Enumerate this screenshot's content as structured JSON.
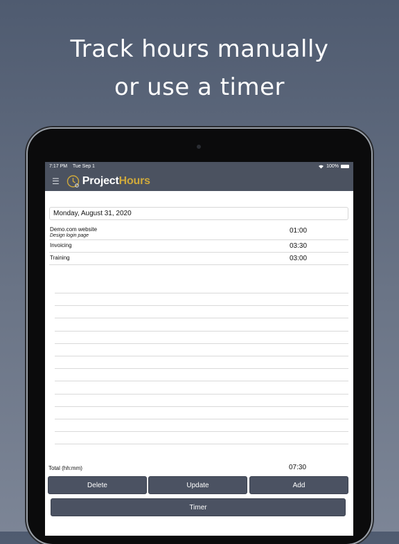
{
  "promo": {
    "line1": "Track hours manually",
    "line2": "or use a timer"
  },
  "statusbar": {
    "time": "7:17 PM",
    "date": "Tue Sep 1",
    "battery": "100%"
  },
  "app": {
    "brand_part1": "Project",
    "brand_part2": "Hours"
  },
  "date_value": "Monday, August 31, 2020",
  "entries": [
    {
      "name": "Demo.com website",
      "sub": "Design login page",
      "time": "01:00"
    },
    {
      "name": "Invoicing",
      "sub": "",
      "time": "03:30"
    },
    {
      "name": "Training",
      "sub": "",
      "time": "03:00"
    }
  ],
  "total": {
    "label": "Total (hh:mm)",
    "value": "07:30"
  },
  "buttons": {
    "delete": "Delete",
    "update": "Update",
    "add": "Add",
    "timer": "Timer"
  },
  "icons": {
    "menu": "hamburger-menu-icon",
    "logo": "clock-logo-icon",
    "wifi": "wifi-icon",
    "battery": "battery-icon"
  },
  "colors": {
    "toolbar": "#4b5260",
    "brand_accent": "#cfa93b",
    "button": "#4b5262"
  }
}
